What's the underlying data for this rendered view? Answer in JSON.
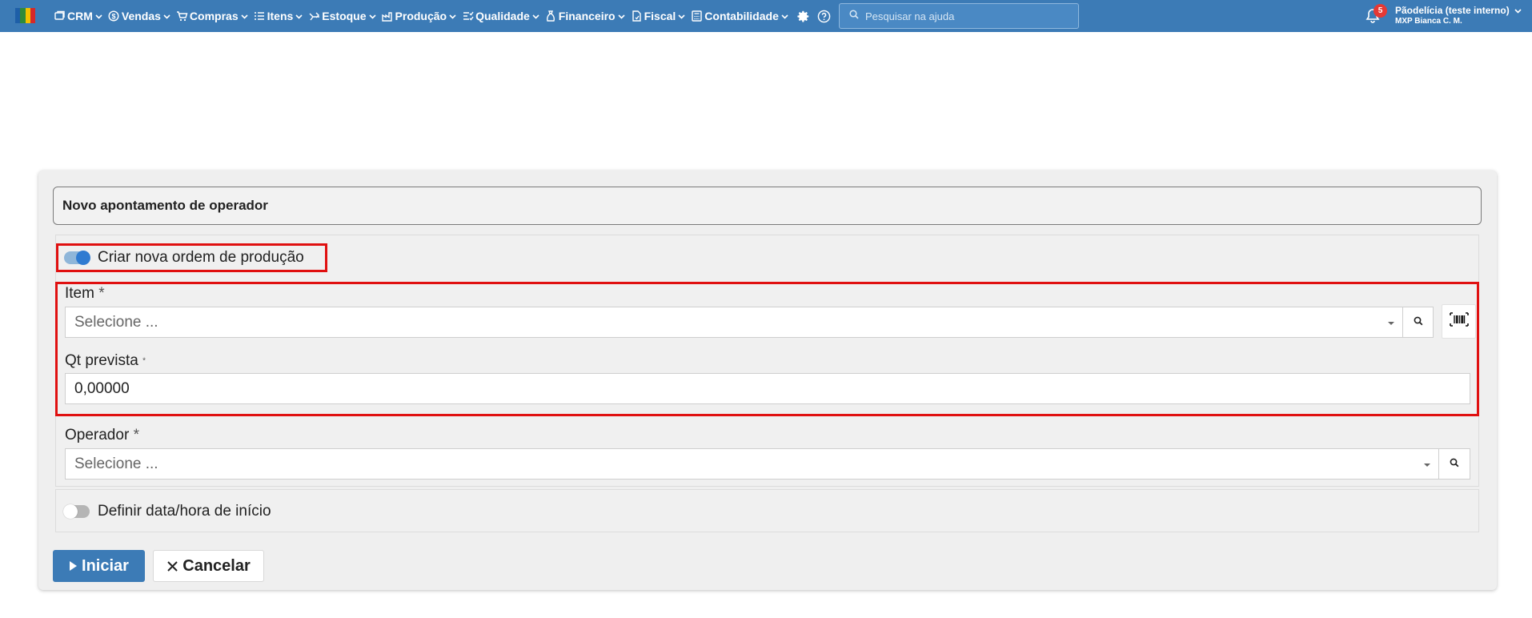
{
  "nav": {
    "items": [
      {
        "label": "CRM",
        "icon": "crm-icon"
      },
      {
        "label": "Vendas",
        "icon": "dollar-icon"
      },
      {
        "label": "Compras",
        "icon": "cart-icon"
      },
      {
        "label": "Itens",
        "icon": "tag-icon"
      },
      {
        "label": "Estoque",
        "icon": "stock-icon"
      },
      {
        "label": "Produção",
        "icon": "factory-icon"
      },
      {
        "label": "Qualidade",
        "icon": "quality-icon"
      },
      {
        "label": "Financeiro",
        "icon": "finance-icon"
      },
      {
        "label": "Fiscal",
        "icon": "fiscal-icon"
      },
      {
        "label": "Contabilidade",
        "icon": "calculator-icon"
      }
    ],
    "search_placeholder": "Pesquisar na ajuda",
    "notification_count": "5",
    "user_name": "Pãodelícia (teste interno)",
    "user_sub": "MXP Bianca C. M."
  },
  "form": {
    "title": "Novo apontamento de operador",
    "create_order_toggle": {
      "label": "Criar nova ordem de produção",
      "on": true
    },
    "item": {
      "label": "Item",
      "required_mark": "*",
      "placeholder": "Selecione ..."
    },
    "qty": {
      "label": "Qt prevista",
      "required_mark": "*",
      "value": "0,00000"
    },
    "operator": {
      "label": "Operador",
      "required_mark": "*",
      "placeholder": "Selecione ..."
    },
    "start_toggle": {
      "label": "Definir data/hora de início",
      "on": false
    },
    "start_button": "Iniciar",
    "cancel_button": "Cancelar"
  },
  "colors": {
    "topbar": "#3c7bb6",
    "primary": "#3c7bb6",
    "highlight": "#e01010",
    "badge": "#e53935"
  }
}
